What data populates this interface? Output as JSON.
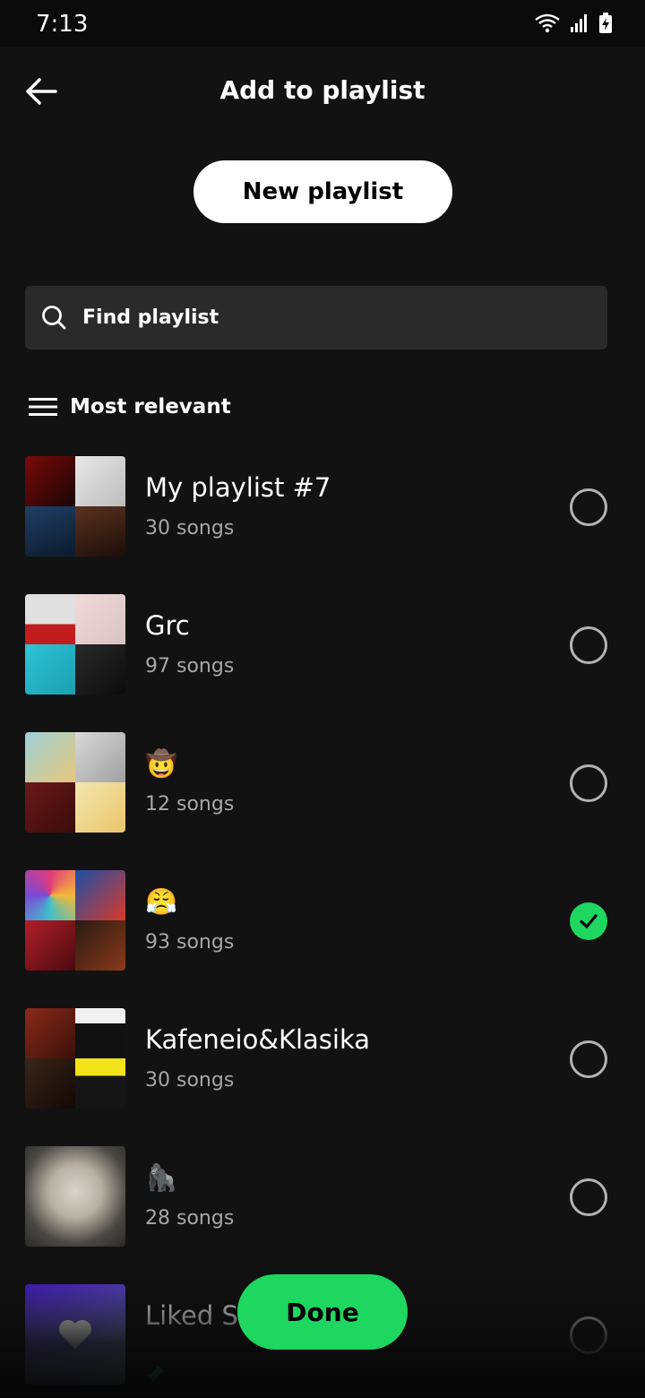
{
  "status": {
    "time": "7:13"
  },
  "header": {
    "title": "Add to playlist",
    "back_icon": "arrow-left-icon"
  },
  "new_playlist_label": "New playlist",
  "search": {
    "placeholder": "Find playlist"
  },
  "sort": {
    "label": "Most relevant"
  },
  "playlists": [
    {
      "name": "My playlist #7",
      "count": "30 songs",
      "selected": false
    },
    {
      "name": "Grc",
      "count": "97 songs",
      "selected": false
    },
    {
      "name": "🤠",
      "count": "12 songs",
      "selected": false
    },
    {
      "name": "😤",
      "count": "93 songs",
      "selected": true
    },
    {
      "name": "Kafeneio&Klasika",
      "count": "30 songs",
      "selected": false
    },
    {
      "name": "🦍",
      "count": "28 songs",
      "selected": false
    },
    {
      "name": "Liked S",
      "count": "",
      "selected": false
    }
  ],
  "done_label": "Done",
  "colors": {
    "accent": "#1ed760",
    "background": "#121212",
    "search_bg": "#2a2a2a"
  }
}
